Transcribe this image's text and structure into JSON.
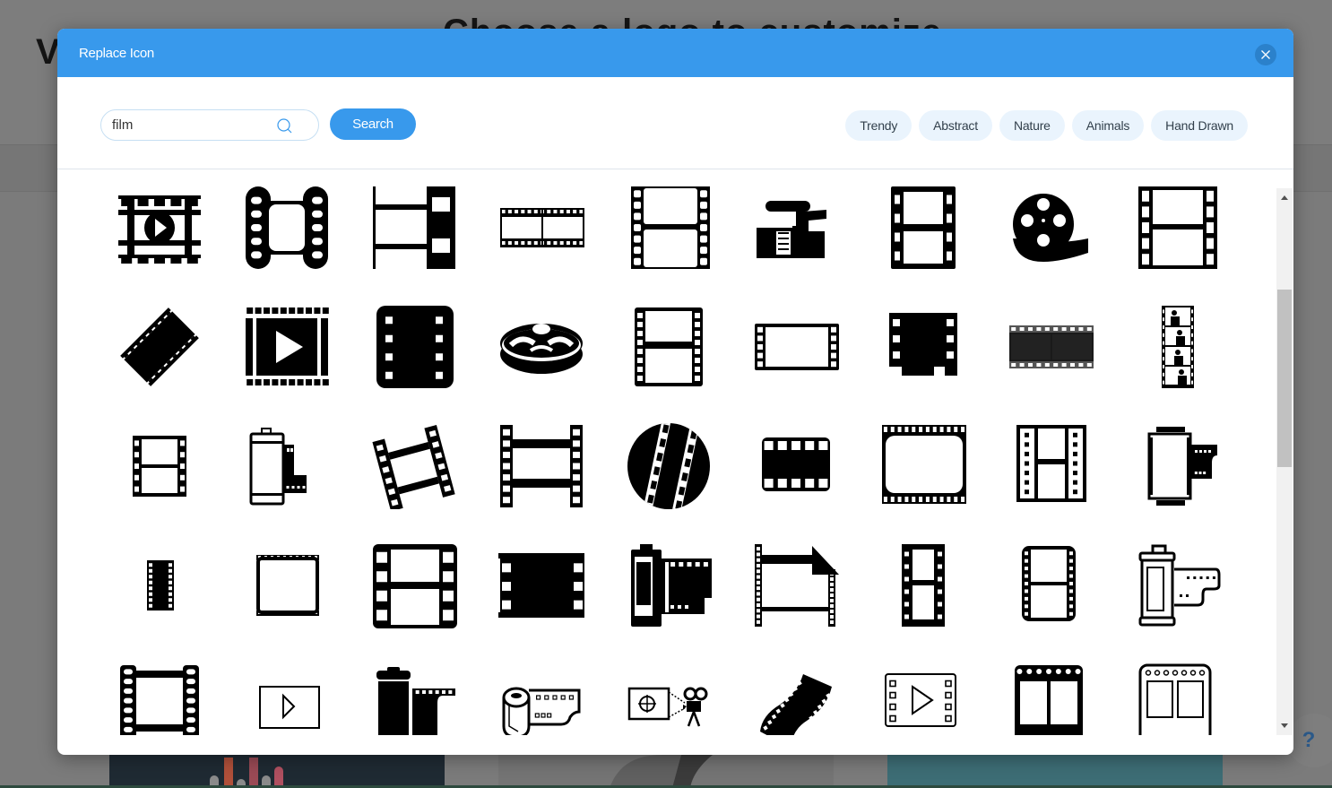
{
  "background": {
    "logo_letter": "V",
    "heading": "Choose a logo to customize",
    "help_label": "?"
  },
  "modal": {
    "title": "Replace Icon",
    "close_icon": "close-icon",
    "search": {
      "value": "film",
      "placeholder": "",
      "button_label": "Search"
    },
    "categories": [
      "Trendy",
      "Abstract",
      "Nature",
      "Animals",
      "Hand Drawn"
    ],
    "colors": {
      "accent": "#3899ec",
      "chip_bg": "#eaf4fd",
      "close_bg": "#2b81cb"
    },
    "results": [
      "film-frame-play-icon",
      "film-strip-rounded-icon",
      "film-strip-half-icon",
      "film-negative-wide-icon",
      "film-strip-two-frames-icon",
      "video-camera-icon",
      "film-strip-bold-icon",
      "film-reel-unrolled-icon",
      "film-strip-square-icon",
      "film-strip-diagonal-icon",
      "video-play-frame-icon",
      "film-card-solid-icon",
      "film-reel-3d-icon",
      "film-strip-outline-icon",
      "film-landscape-frame-icon",
      "film-solid-cutout-icon",
      "film-negative-dark-icon",
      "film-strip-portraits-icon",
      "film-small-two-frames-icon",
      "film-canister-icon",
      "film-strip-tilted-icon",
      "film-single-frame-icon",
      "film-circle-strips-icon",
      "film-rounded-solid-icon",
      "film-wide-rounded-icon",
      "film-strip-columns-icon",
      "film-roll-cartridge-icon",
      "film-mini-strip-icon",
      "film-slide-frame-icon",
      "film-frame-large-icon",
      "film-solid-frame-icon",
      "film-cartridge-bold-icon",
      "film-strip-curl-icon",
      "film-strip-tall-icon",
      "film-strip-rounded-outline-icon",
      "film-roll-outline-icon",
      "film-strip-holes-icon",
      "film-play-small-icon",
      "film-canister-solid-icon",
      "film-roll-open-icon",
      "film-projector-icon",
      "film-strip-wave-icon",
      "video-file-play-icon",
      "film-two-frames-solid-icon",
      "film-two-frames-outline-icon"
    ]
  },
  "scrollbar": {
    "position_fraction": 0.25
  }
}
